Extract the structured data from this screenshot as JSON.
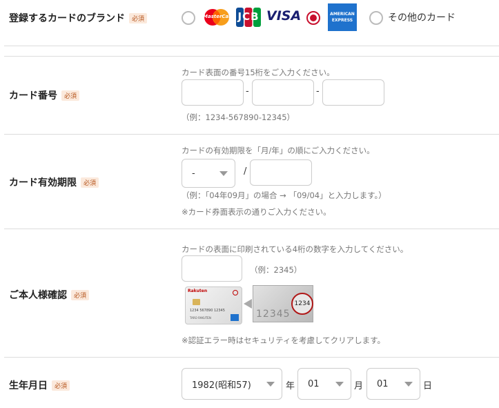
{
  "brand": {
    "label": "登録するカードのブランド",
    "required": "必須",
    "options": [
      {
        "name": "mastercard",
        "text": "MasterCard",
        "selected": false
      },
      {
        "name": "jcb",
        "text": "JCB",
        "selected": false
      },
      {
        "name": "visa",
        "text": "VISA",
        "selected": false
      },
      {
        "name": "amex",
        "text_top": "AMERICAN",
        "text_bottom": "EXPRESS",
        "selected": true
      },
      {
        "name": "other",
        "text": "その他のカード",
        "selected": false
      }
    ]
  },
  "card_number": {
    "label": "カード番号",
    "required": "必須",
    "hint": "カード表面の番号15桁をご入力ください。",
    "dash": "-",
    "example": "（例：1234-567890-12345）"
  },
  "expiry": {
    "label": "カード有効期限",
    "required": "必須",
    "hint": "カードの有効期限を「月/年」の順にご入力ください。",
    "month_value": "-",
    "slash": "/",
    "example": "（例：「04年09月」の場合 → 「09/04」と入力します。）",
    "note": "※カード券面表示の通りご入力ください。"
  },
  "cvv": {
    "label": "ご本人様確認",
    "required": "必須",
    "hint": "カードの表面に印刷されている4桁の数字を入力してください。",
    "example": "（例：2345）",
    "card_brand": "Rakuten",
    "card_number_text": "1234 567890 12345",
    "card_holder": "TARO RAKUTEN",
    "zoom_code": "1234",
    "zoom_number": "12345",
    "note": "※認証エラー時はセキュリティを考慮してクリアします。"
  },
  "birth": {
    "label": "生年月日",
    "required": "必須",
    "year_value": "1982(昭和57)",
    "year_unit": "年",
    "month_value": "01",
    "month_unit": "月",
    "day_value": "01",
    "day_unit": "日"
  },
  "colors": {
    "accent_red": "#c8102e",
    "required_bg": "#fbe9dc",
    "required_text": "#b5541b",
    "border": "#cccccc"
  }
}
